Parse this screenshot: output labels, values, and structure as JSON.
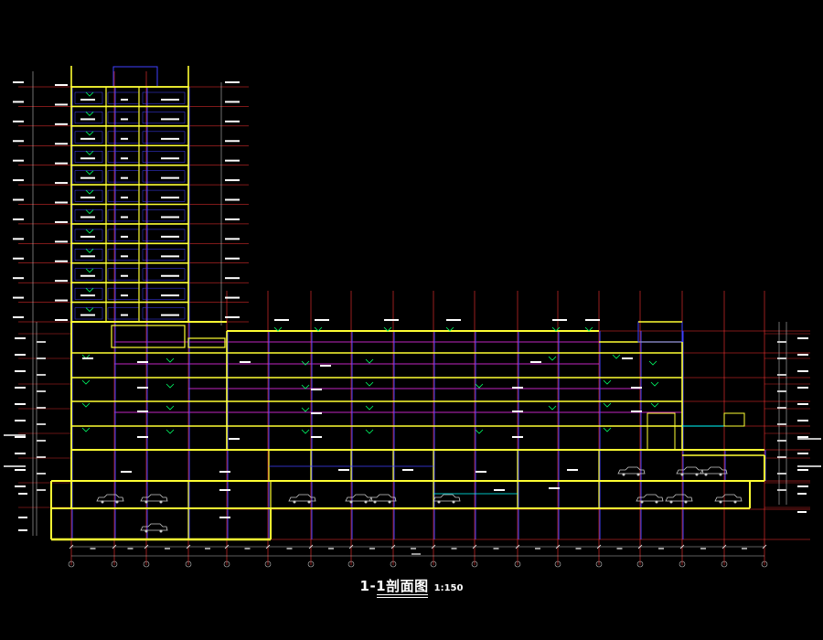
{
  "drawing": {
    "title": "1-1剖面图",
    "scale": "1:150"
  },
  "colors": {
    "background": "#000000",
    "slab": "#ffff33",
    "wall": "#ffff33",
    "grid": "#ff3333",
    "column": "#4040ff",
    "partition": "#00ffff",
    "marker": "#00ff66",
    "beam": "#ff33ff",
    "text": "#ffffff",
    "dimension": "#bbbbbb"
  },
  "section": {
    "tower_floors": 12,
    "podium_floors": 4,
    "basement_levels": 2
  }
}
